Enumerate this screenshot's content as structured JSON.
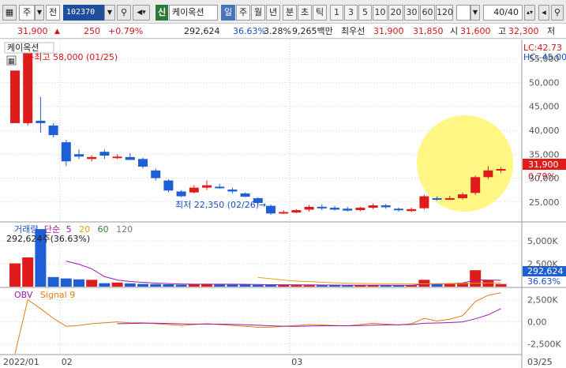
{
  "toolbar": {
    "market_selector": "주",
    "jeon_label": "전",
    "stock_code": "102370",
    "stock_name": "케이옥션",
    "sin_label": "신",
    "periods": [
      "일",
      "주",
      "월",
      "년",
      "분",
      "초",
      "틱"
    ],
    "active_period": "일",
    "numbers": [
      "1",
      "3",
      "5",
      "10",
      "20",
      "30",
      "60",
      "120"
    ],
    "page_counter": "40/40"
  },
  "quote": {
    "price": "31,900",
    "change": "250",
    "change_pct": "+0.79%",
    "volume": "292,624",
    "vol_ratio": "36.63%",
    "turnover": "3.28%",
    "amount": "9,265백만",
    "best_ask_label": "최우선",
    "best_ask": "31,900",
    "best_bid": "31,850",
    "open_label": "시",
    "open": "31,600",
    "high_label": "고",
    "high": "32,300",
    "low_label": "저"
  },
  "colors": {
    "up": "#e01b1b",
    "down": "#1f5fd6",
    "ma_line": "#9c1aa8",
    "signal_line": "#e57c1a",
    "highlight": "#fff575"
  },
  "chart_data": {
    "type": "candlestick",
    "panel_title": "케이옥션",
    "max_annotation": "최고 58,000 (01/25)",
    "min_annotation": "최저 22,350 (02/26)",
    "lc_label": "LC:42.73",
    "hc_label": "HC:-45.00",
    "current_price_label": "31,900",
    "current_pct_label": "0.79%",
    "price_ticks": [
      "55,000",
      "50,000",
      "45,000",
      "40,000",
      "35,000",
      "30,000",
      "25,000"
    ],
    "price_tick_values": [
      55000,
      50000,
      45000,
      40000,
      35000,
      30000,
      25000
    ],
    "ylim": [
      21000,
      59000
    ],
    "candles": [
      {
        "o": 41500,
        "h": 52500,
        "l": 41500,
        "c": 52500
      },
      {
        "o": 41500,
        "h": 58000,
        "l": 41000,
        "c": 57500
      },
      {
        "o": 42000,
        "h": 47000,
        "l": 39500,
        "c": 41500
      },
      {
        "o": 41000,
        "h": 41500,
        "l": 38500,
        "c": 39000
      },
      {
        "o": 37500,
        "h": 38000,
        "l": 32500,
        "c": 33500
      },
      {
        "o": 35000,
        "h": 36000,
        "l": 34000,
        "c": 34500
      },
      {
        "o": 34000,
        "h": 34800,
        "l": 33500,
        "c": 34400
      },
      {
        "o": 35500,
        "h": 36000,
        "l": 34000,
        "c": 34700
      },
      {
        "o": 34400,
        "h": 35000,
        "l": 34000,
        "c": 34500
      },
      {
        "o": 34400,
        "h": 35200,
        "l": 33800,
        "c": 33800
      },
      {
        "o": 34000,
        "h": 34300,
        "l": 32000,
        "c": 32400
      },
      {
        "o": 31600,
        "h": 32000,
        "l": 29500,
        "c": 30000
      },
      {
        "o": 29500,
        "h": 29800,
        "l": 27000,
        "c": 27400
      },
      {
        "o": 27200,
        "h": 27500,
        "l": 26000,
        "c": 26200
      },
      {
        "o": 27000,
        "h": 28500,
        "l": 26800,
        "c": 28000
      },
      {
        "o": 28000,
        "h": 29500,
        "l": 27500,
        "c": 28500
      },
      {
        "o": 28200,
        "h": 28800,
        "l": 27800,
        "c": 28000
      },
      {
        "o": 27600,
        "h": 28000,
        "l": 26800,
        "c": 27200
      },
      {
        "o": 26800,
        "h": 27000,
        "l": 26000,
        "c": 26100
      },
      {
        "o": 25800,
        "h": 26000,
        "l": 24500,
        "c": 24800
      },
      {
        "o": 24200,
        "h": 24500,
        "l": 22350,
        "c": 22600
      },
      {
        "o": 22700,
        "h": 23300,
        "l": 22500,
        "c": 22900
      },
      {
        "o": 22800,
        "h": 23500,
        "l": 22700,
        "c": 23300
      },
      {
        "o": 23400,
        "h": 24400,
        "l": 23000,
        "c": 24000
      },
      {
        "o": 24000,
        "h": 24500,
        "l": 23300,
        "c": 23700
      },
      {
        "o": 23800,
        "h": 24200,
        "l": 23200,
        "c": 23400
      },
      {
        "o": 23600,
        "h": 24000,
        "l": 23000,
        "c": 23200
      },
      {
        "o": 23300,
        "h": 24000,
        "l": 23100,
        "c": 23800
      },
      {
        "o": 23800,
        "h": 24700,
        "l": 23500,
        "c": 24300
      },
      {
        "o": 24300,
        "h": 24600,
        "l": 23600,
        "c": 23900
      },
      {
        "o": 23600,
        "h": 23800,
        "l": 23000,
        "c": 23300
      },
      {
        "o": 23100,
        "h": 23800,
        "l": 22900,
        "c": 23500
      },
      {
        "o": 23700,
        "h": 26500,
        "l": 23500,
        "c": 26200
      },
      {
        "o": 25800,
        "h": 26200,
        "l": 25300,
        "c": 25500
      },
      {
        "o": 25600,
        "h": 26300,
        "l": 25400,
        "c": 25800
      },
      {
        "o": 25800,
        "h": 27000,
        "l": 25500,
        "c": 26600
      },
      {
        "o": 26900,
        "h": 30500,
        "l": 26500,
        "c": 30200
      },
      {
        "o": 30200,
        "h": 32500,
        "l": 29800,
        "c": 31600
      },
      {
        "o": 31600,
        "h": 32300,
        "l": 31100,
        "c": 31900
      }
    ],
    "volume": {
      "title": "거래량",
      "ma_label": "단순",
      "ma_periods": [
        "5",
        "20",
        "60",
        "120"
      ],
      "current_label": "292,624주(36.63%)",
      "ticks": [
        "5,000K",
        "2,500K"
      ],
      "tick_values": [
        5000,
        2500
      ],
      "ylim": [
        0,
        7000
      ],
      "value_label": "292,624",
      "pct_label": "36.63%",
      "values": [
        2550,
        3200,
        6300,
        1050,
        900,
        800,
        750,
        380,
        450,
        360,
        300,
        280,
        260,
        220,
        290,
        310,
        250,
        230,
        220,
        200,
        180,
        170,
        160,
        150,
        150,
        140,
        140,
        160,
        170,
        150,
        140,
        150,
        750,
        300,
        320,
        430,
        1800,
        700,
        292
      ],
      "ma5": [
        null,
        null,
        null,
        null,
        2800,
        2450,
        1950,
        1100,
        720,
        560,
        470,
        390,
        330,
        290,
        270,
        270,
        270,
        270,
        260,
        240,
        220,
        210,
        200,
        190,
        180,
        170,
        160,
        160,
        160,
        160,
        155,
        155,
        270,
        310,
        340,
        400,
        720,
        720,
        700
      ],
      "ma20": [
        null,
        null,
        null,
        null,
        null,
        null,
        null,
        null,
        null,
        null,
        null,
        null,
        null,
        null,
        null,
        null,
        null,
        null,
        null,
        1000,
        880,
        720,
        600,
        560,
        480,
        420,
        380,
        350,
        330,
        320,
        300,
        290,
        310,
        320,
        330,
        340,
        380,
        400,
        410
      ]
    },
    "obv": {
      "title": "OBV",
      "signal_label": "Signal 9",
      "ticks": [
        "2,500K",
        "0,00",
        "-2,500K"
      ],
      "tick_values": [
        2500,
        0,
        -2500
      ],
      "ylim": [
        -3600,
        3800
      ],
      "obv": [
        -3600,
        2500,
        1500,
        400,
        -500,
        -400,
        -200,
        -100,
        0,
        -100,
        -100,
        -200,
        -300,
        -400,
        -300,
        -200,
        -300,
        -400,
        -500,
        -600,
        -600,
        -500,
        -400,
        -300,
        -350,
        -400,
        -450,
        -300,
        -150,
        -250,
        -350,
        -200,
        400,
        100,
        300,
        700,
        2300,
        3000,
        3300
      ],
      "signal": [
        null,
        null,
        null,
        null,
        null,
        null,
        null,
        null,
        -200,
        -180,
        -150,
        -150,
        -180,
        -220,
        -240,
        -250,
        -260,
        -280,
        -320,
        -380,
        -450,
        -490,
        -500,
        -470,
        -450,
        -440,
        -430,
        -410,
        -370,
        -340,
        -320,
        -290,
        -160,
        -120,
        -80,
        0,
        350,
        800,
        1500
      ]
    },
    "x_labels": [
      {
        "index": 0,
        "text": "2022/01"
      },
      {
        "index": 4,
        "text": "02"
      },
      {
        "index": 22,
        "text": "03"
      },
      {
        "index": 42,
        "text": "03/25"
      }
    ]
  }
}
